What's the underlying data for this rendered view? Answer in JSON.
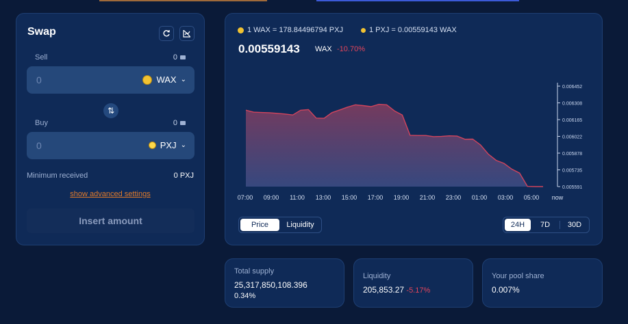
{
  "swap": {
    "title": "Swap",
    "sell_label": "Sell",
    "sell_balance": "0",
    "sell_value": "0",
    "sell_token": "WAX",
    "buy_label": "Buy",
    "buy_balance": "0",
    "buy_value": "0",
    "buy_token": "PXJ",
    "min_received_label": "Minimum received",
    "min_received_value": "0 PXJ",
    "advanced_link": "show advanced settings",
    "submit_label": "Insert amount",
    "icons": [
      "refresh-icon",
      "chart-hide-icon",
      "wallet-icon",
      "swap-direction-icon",
      "chevron-down-icon"
    ]
  },
  "chart": {
    "rate_1": "1 WAX = 178.84496794 PXJ",
    "rate_2": "1 PXJ = 0.00559143 WAX",
    "price": "0.00559143",
    "price_unit": "WAX",
    "price_change": "-10.70%",
    "type_tabs": [
      "Price",
      "Liquidity"
    ],
    "range_tabs": [
      "24H",
      "7D",
      "30D"
    ],
    "active_type": "Price",
    "active_range": "24H",
    "line_color": "#d3445c"
  },
  "chart_data": {
    "type": "area",
    "x": [
      "07:00",
      "09:00",
      "11:00",
      "13:00",
      "15:00",
      "17:00",
      "19:00",
      "21:00",
      "23:00",
      "01:00",
      "03:00",
      "05:00",
      "now"
    ],
    "y_ticks": [
      "0.006452",
      "0.006308",
      "0.006165",
      "0.006022",
      "0.005878",
      "0.005735",
      "0.005591"
    ],
    "ylim": [
      0.005591,
      0.006452
    ],
    "series": [
      {
        "values": [
          0.006246,
          0.006229,
          0.006226,
          0.006224,
          0.006219,
          0.006213,
          0.006205,
          0.006245,
          0.006251,
          0.006178,
          0.006176,
          0.006225,
          0.006248,
          0.006272,
          0.006292,
          0.006285,
          0.006276,
          0.006296,
          0.006292,
          0.00624,
          0.006205,
          0.006031,
          0.006029,
          0.006029,
          0.006019,
          0.006021,
          0.006026,
          0.006024,
          0.005997,
          0.005998,
          0.005948,
          0.005869,
          0.005816,
          0.00579,
          0.005741,
          0.005707,
          0.005593,
          0.005591,
          0.005591
        ]
      }
    ]
  },
  "stats": {
    "total_supply_label": "Total supply",
    "total_supply_value": "25,317,850,108.396",
    "total_supply_change": "0.34%",
    "liquidity_label": "Liquidity",
    "liquidity_value": "205,853.27",
    "liquidity_change": "-5.17%",
    "pool_share_label": "Your pool share",
    "pool_share_value": "0.007%"
  }
}
